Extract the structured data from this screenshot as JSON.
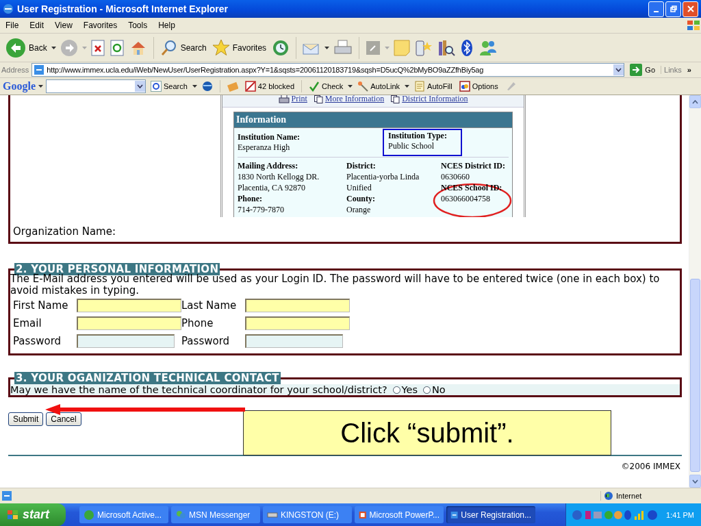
{
  "window": {
    "title": "User Registration - Microsoft Internet Explorer"
  },
  "menu": [
    "File",
    "Edit",
    "View",
    "Favorites",
    "Tools",
    "Help"
  ],
  "toolbar": {
    "back": "Back",
    "search": "Search",
    "favorites": "Favorites"
  },
  "address": {
    "label": "Address",
    "url": "http://www.immex.ucla.edu/iWeb/NewUser/UserRegistration.aspx?Y=1&sqsts=20061120183719&sqsh=D5ucQ%2bMyBO9aZZfhBiy5ag",
    "go": "Go",
    "links": "Links",
    "more": "»"
  },
  "google_bar": {
    "logo": "Google",
    "search": "Search",
    "blocked": "42 blocked",
    "check": "Check",
    "autolink": "AutoLink",
    "autofill": "AutoFill",
    "options": "Options"
  },
  "info_panel": {
    "links": [
      "Print",
      "More Information",
      "District Information"
    ],
    "title": "Information",
    "top": [
      {
        "label": "Institution Name:",
        "value": "Esperanza High",
        "highlight": false
      },
      {
        "label": "Institution Type:",
        "value": "Public School",
        "highlight": true
      }
    ],
    "columns": [
      {
        "lines": [
          {
            "text": "Mailing Address:",
            "bold": true
          },
          {
            "text": "1830 North Kellogg DR.",
            "bold": false
          },
          {
            "text": "Placentia, CA 92870",
            "bold": false
          },
          {
            "text": "Phone:",
            "bold": true
          },
          {
            "text": "714-779-7870",
            "bold": false
          }
        ]
      },
      {
        "lines": [
          {
            "text": "District:",
            "bold": true
          },
          {
            "text": "Placentia-yorba Linda",
            "bold": false
          },
          {
            "text": "Unified",
            "bold": false
          },
          {
            "text": "County:",
            "bold": true
          },
          {
            "text": "Orange",
            "bold": false
          }
        ]
      },
      {
        "lines": [
          {
            "text": "NCES District ID:",
            "bold": true
          },
          {
            "text": "0630660",
            "bold": false
          },
          {
            "text": "NCES School ID:",
            "bold": true
          },
          {
            "text": "063066004758",
            "bold": false
          }
        ]
      }
    ]
  },
  "organization_label": "Organization Name:",
  "personal": {
    "legend": "2. YOUR PERSONAL INFORMATION",
    "note": "The E-Mail address you entered will be used as your Login ID. The password will have to be entered twice (one in each box) to avoid mistakes in typing.",
    "fields": [
      {
        "label": "First Name",
        "kind": "text"
      },
      {
        "label": "Last Name",
        "kind": "text"
      },
      {
        "label": "Email",
        "kind": "text"
      },
      {
        "label": "Phone",
        "kind": "text"
      },
      {
        "label": "Password",
        "kind": "password"
      },
      {
        "label": "Password",
        "kind": "password"
      }
    ]
  },
  "contact": {
    "legend": "3. YOUR OGANIZATION TECHNICAL CONTACT",
    "question": "May we have the name of the technical coordinator for your school/district?",
    "options": [
      {
        "label": "Yes",
        "selected": false
      },
      {
        "label": "No",
        "selected": false
      }
    ]
  },
  "buttons": [
    "Submit",
    "Cancel"
  ],
  "callout": "Click “submit”.",
  "footer": "©2006 IMMEX",
  "status_bar": {
    "zone": "Internet"
  },
  "taskbar": {
    "start": "start",
    "tasks": [
      {
        "label": "Microsoft Active...",
        "selected": false
      },
      {
        "label": "MSN Messenger",
        "selected": false
      },
      {
        "label": "KINGSTON (E:)",
        "selected": false
      },
      {
        "label": "Microsoft PowerP...",
        "selected": false
      },
      {
        "label": "User Registration...",
        "selected": true
      }
    ],
    "time": "1:41 PM"
  }
}
